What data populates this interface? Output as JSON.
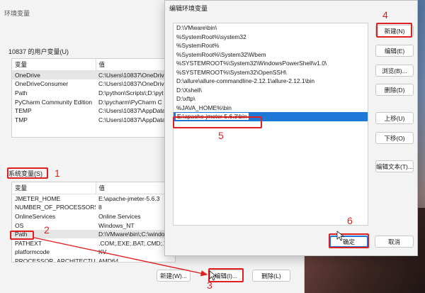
{
  "env_window": {
    "title": "环境变量",
    "user_section_label": "10837 的用户变量(U)",
    "user_table": {
      "headers": [
        "变量",
        "值"
      ],
      "rows": [
        [
          "OneDrive",
          "C:\\Users\\10837\\OneDrive"
        ],
        [
          "OneDriveConsumer",
          "C:\\Users\\10837\\OneDrive"
        ],
        [
          "Path",
          "D:\\python\\Scripts\\;D:\\pyt"
        ],
        [
          "PyCharm Community Edition",
          "D:\\pycharm\\PyCharm C"
        ],
        [
          "TEMP",
          "C:\\Users\\10837\\AppData"
        ],
        [
          "TMP",
          "C:\\Users\\10837\\AppData"
        ]
      ]
    },
    "system_section_label": "系统变量(S)",
    "system_table": {
      "headers": [
        "变量",
        "值"
      ],
      "rows": [
        [
          "JMETER_HOME",
          "E:\\apache-jmeter-5.6.3"
        ],
        [
          "NUMBER_OF_PROCESSORS",
          "8"
        ],
        [
          "OnlineServices",
          "Online Services"
        ],
        [
          "OS",
          "Windows_NT"
        ],
        [
          "Path",
          "D:\\VMware\\bin\\;C:\\windo"
        ],
        [
          "PATHEXT",
          ".COM;.EXE;.BAT;.CMD;.V"
        ],
        [
          "platformcode",
          "KV"
        ],
        [
          "PROCESSOR_ARCHITECTURE",
          "AMD64"
        ]
      ]
    },
    "buttons": {
      "new": "新建(W)...",
      "edit": "编辑(I)...",
      "delete": "删除(L)"
    }
  },
  "edit_dialog": {
    "title": "编辑环境变量",
    "paths": [
      "D:\\VMware\\bin\\",
      "%SystemRoot%\\system32",
      "%SystemRoot%",
      "%SystemRoot%\\System32\\Wbem",
      "%SYSTEMROOT%\\System32\\WindowsPowerShell\\v1.0\\",
      "%SYSTEMROOT%\\System32\\OpenSSH\\",
      "D:\\allure\\allure-commandline-2.12.1\\allure-2.12.1\\bin",
      "D:\\Xshell\\",
      "D:\\xftp\\",
      "%JAVA_HOME%\\bin"
    ],
    "editing_value": "E:\\apache-jmeter-5.6.3\\bin",
    "side_buttons": {
      "new": "新建(N)",
      "edit": "编辑(E)",
      "browse": "浏览(B)...",
      "delete": "删除(D)",
      "move_up": "上移(U)",
      "move_down": "下移(O)",
      "edit_text": "编辑文本(T)..."
    },
    "ok": "确定",
    "cancel": "取消"
  },
  "annotations": {
    "step1": "1",
    "step2": "2",
    "step3": "3",
    "step4": "4",
    "step5": "5",
    "step6": "6",
    "color": "#e02020"
  }
}
